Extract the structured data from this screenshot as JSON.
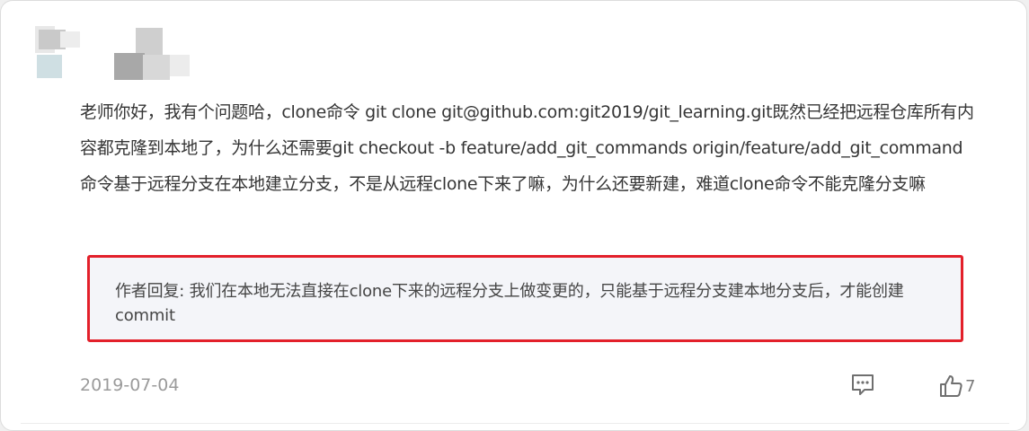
{
  "comment": {
    "text": "老师你好，我有个问题哈，clone命令 git clone git@github.com:git2019/git_learning.git既然已经把远程仓库所有内容都克隆到本地了，为什么还需要git checkout -b feature/add_git_commands origin/feature/add_git_command 命令基于远程分支在本地建立分支，不是从远程clone下来了嘛，为什么还要新建，难道clone命令不能克隆分支嘛",
    "date": "2019-07-04"
  },
  "reply": {
    "text": "作者回复: 我们在本地无法直接在clone下来的远程分支上做变更的，只能基于远程分支建本地分支后，才能创建commit"
  },
  "actions": {
    "comment_icon": "comment-bubble-icon",
    "like_icon": "thumbs-up-icon",
    "like_count": "7"
  },
  "colors": {
    "highlight_border": "#e3202a",
    "reply_background": "#f4f5f9",
    "text": "#353535",
    "muted": "#9b9b9b"
  }
}
